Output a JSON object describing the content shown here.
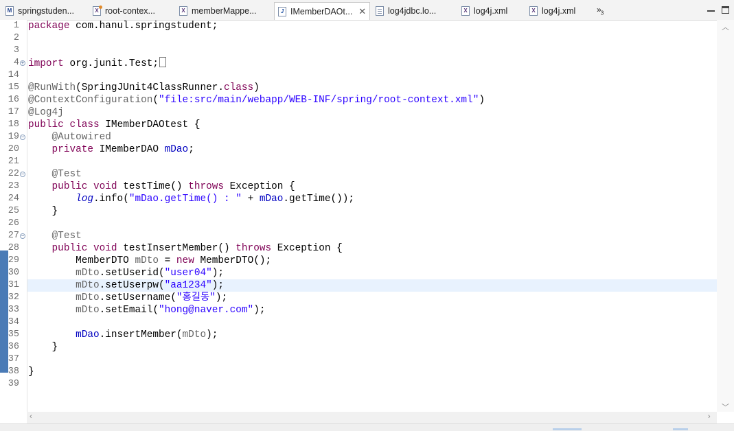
{
  "tabs": [
    {
      "label": "springstuden...",
      "icon": "maven-pom-file-icon",
      "glyph": "M"
    },
    {
      "label": "root-contex...",
      "icon": "spring-xml-file-icon",
      "glyph": "X"
    },
    {
      "label": "memberMappe...",
      "icon": "xml-file-icon",
      "glyph": "X"
    },
    {
      "label": "IMemberDAOt...",
      "icon": "java-file-icon",
      "glyph": "J",
      "active": true
    },
    {
      "label": "log4jdbc.lo...",
      "icon": "text-file-icon",
      "glyph": ""
    },
    {
      "label": "log4j.xml",
      "icon": "xml-file-icon",
      "glyph": "X"
    },
    {
      "label": "log4j.xml",
      "icon": "xml-file-icon",
      "glyph": "X"
    }
  ],
  "overflow": {
    "symbol": "»",
    "count": "3"
  },
  "editor": {
    "line_numbers": [
      "1",
      "2",
      "3",
      "4",
      "14",
      "15",
      "16",
      "17",
      "18",
      "19",
      "20",
      "21",
      "22",
      "23",
      "24",
      "25",
      "26",
      "27",
      "28",
      "29",
      "30",
      "31",
      "32",
      "33",
      "34",
      "35",
      "36",
      "37",
      "38",
      "39"
    ],
    "highlighted_line": "31",
    "lines": [
      [
        {
          "t": "package",
          "c": "kw"
        },
        {
          "t": " com.hanul.springstudent;"
        }
      ],
      [],
      [],
      [
        {
          "t": "import",
          "c": "kw"
        },
        {
          "t": " org.junit.Test;"
        }
      ],
      [],
      [
        {
          "t": "@RunWith",
          "c": "ann"
        },
        {
          "t": "(SpringJUnit4ClassRunner."
        },
        {
          "t": "class",
          "c": "kw"
        },
        {
          "t": ")"
        }
      ],
      [
        {
          "t": "@ContextConfiguration",
          "c": "ann"
        },
        {
          "t": "("
        },
        {
          "t": "\"file:src/main/webapp/WEB-INF/spring/root-context.xml\"",
          "c": "str"
        },
        {
          "t": ")"
        }
      ],
      [
        {
          "t": "@Log4j",
          "c": "ann"
        }
      ],
      [
        {
          "t": "public",
          "c": "kw"
        },
        {
          "t": " "
        },
        {
          "t": "class",
          "c": "kw"
        },
        {
          "t": " IMemberDAOtest {"
        }
      ],
      [
        {
          "t": "    "
        },
        {
          "t": "@Autowired",
          "c": "ann"
        }
      ],
      [
        {
          "t": "    "
        },
        {
          "t": "private",
          "c": "kw"
        },
        {
          "t": " IMemberDAO "
        },
        {
          "t": "mDao",
          "c": "fld"
        },
        {
          "t": ";"
        }
      ],
      [],
      [
        {
          "t": "    "
        },
        {
          "t": "@Test",
          "c": "ann"
        }
      ],
      [
        {
          "t": "    "
        },
        {
          "t": "public",
          "c": "kw"
        },
        {
          "t": " "
        },
        {
          "t": "void",
          "c": "kw"
        },
        {
          "t": " testTime() "
        },
        {
          "t": "throws",
          "c": "kw"
        },
        {
          "t": " Exception {"
        }
      ],
      [
        {
          "t": "        "
        },
        {
          "t": "log",
          "c": "itl"
        },
        {
          "t": ".info("
        },
        {
          "t": "\"mDao.getTime() : \"",
          "c": "str"
        },
        {
          "t": " + "
        },
        {
          "t": "mDao",
          "c": "fld"
        },
        {
          "t": ".getTime());"
        }
      ],
      [
        {
          "t": "    }"
        }
      ],
      [],
      [
        {
          "t": "    "
        },
        {
          "t": "@Test",
          "c": "ann"
        }
      ],
      [
        {
          "t": "    "
        },
        {
          "t": "public",
          "c": "kw"
        },
        {
          "t": " "
        },
        {
          "t": "void",
          "c": "kw"
        },
        {
          "t": " testInsertMember() "
        },
        {
          "t": "throws",
          "c": "kw"
        },
        {
          "t": " Exception {"
        }
      ],
      [
        {
          "t": "        MemberDTO "
        },
        {
          "t": "mDto",
          "c": "ann"
        },
        {
          "t": " = "
        },
        {
          "t": "new",
          "c": "kw"
        },
        {
          "t": " MemberDTO();"
        }
      ],
      [
        {
          "t": "        "
        },
        {
          "t": "mDto",
          "c": "ann"
        },
        {
          "t": ".setUserid("
        },
        {
          "t": "\"user04\"",
          "c": "str"
        },
        {
          "t": ");"
        }
      ],
      [
        {
          "t": "        "
        },
        {
          "t": "mDto",
          "c": "ann"
        },
        {
          "t": ".setUserpw("
        },
        {
          "t": "\"aa1234\"",
          "c": "str"
        },
        {
          "t": ");"
        }
      ],
      [
        {
          "t": "        "
        },
        {
          "t": "mDto",
          "c": "ann"
        },
        {
          "t": ".setUsername("
        },
        {
          "t": "\"홍길동\"",
          "c": "str"
        },
        {
          "t": ");"
        }
      ],
      [
        {
          "t": "        "
        },
        {
          "t": "mDto",
          "c": "ann"
        },
        {
          "t": ".setEmail("
        },
        {
          "t": "\"hong@naver.com\"",
          "c": "str"
        },
        {
          "t": ");"
        }
      ],
      [],
      [
        {
          "t": "        "
        },
        {
          "t": "mDao",
          "c": "fld"
        },
        {
          "t": ".insertMember("
        },
        {
          "t": "mDto",
          "c": "ann"
        },
        {
          "t": ");"
        }
      ],
      [
        {
          "t": "    }"
        }
      ],
      [],
      [
        {
          "t": "}"
        }
      ],
      []
    ],
    "fold_markers": [
      {
        "line": "4",
        "symbol": "+"
      },
      {
        "line": "19",
        "symbol": "−"
      },
      {
        "line": "22",
        "symbol": "−"
      },
      {
        "line": "27",
        "symbol": "−"
      }
    ]
  },
  "colors": {
    "keyword": "#7f0055",
    "annotation": "#646464",
    "string": "#2a00ff",
    "field": "#0000c0",
    "current_line": "#e8f2fe",
    "ruler": "#4a7bb6"
  }
}
